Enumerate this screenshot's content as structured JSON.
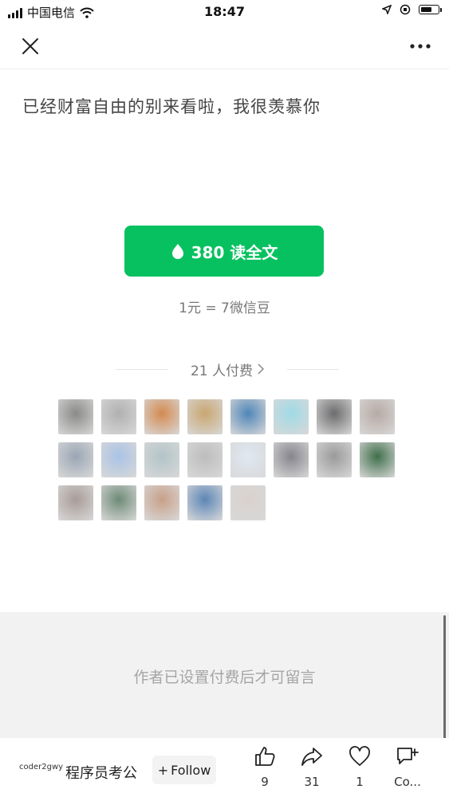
{
  "status": {
    "carrier": "中国电信",
    "time": "18:47",
    "battery_level": 0.7
  },
  "nav": {
    "close_icon": "close-icon",
    "more_icon": "more-dots-icon"
  },
  "article": {
    "title": "已经财富自由的别来看啦，我很羡慕你"
  },
  "paywall": {
    "read_button_label": "380 读全文",
    "price_note": "1元 = 7微信豆",
    "payers_label": "21 人付费",
    "avatars": [
      "#8a8a88",
      "#b0b0b0",
      "#d48a50",
      "#c9a670",
      "#4f86b8",
      "#9fdbe6",
      "#6c6c6e",
      "#b7aaa4",
      "#9aa6b4",
      "#a9c3e6",
      "#b2c4c8",
      "#bdbdbd",
      "#dfe8f3",
      "#85858c",
      "#9a9a9a",
      "#3f6f4a",
      "#a89c96",
      "#6e8a76",
      "#c8a088",
      "#5c86b6",
      "#d9d2ce"
    ]
  },
  "comments": {
    "disabled_note": "作者已设置付费后才可留言"
  },
  "footer": {
    "author_logo": "coder2gwy",
    "author_name": "程序员考公",
    "follow_label": "Follow",
    "actions": {
      "like_count": "9",
      "share_count": "31",
      "wow_count": "1",
      "comment_label": "Co..."
    }
  }
}
